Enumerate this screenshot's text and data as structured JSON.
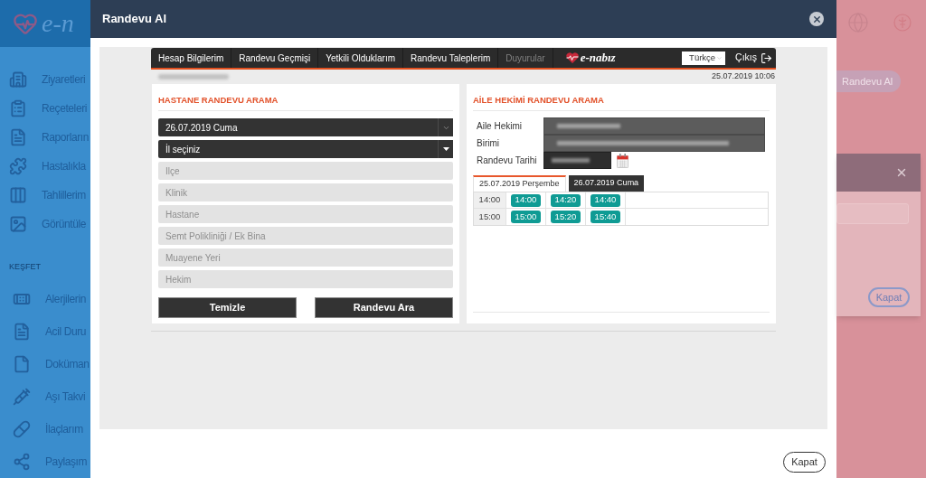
{
  "background": {
    "logo": "e-n",
    "sidebar": {
      "items": [
        "Ziyaretleri",
        "Reçeteleri",
        "Raporların",
        "Hastalıkla",
        "Tahlillerim",
        "Görüntüle"
      ],
      "section": {
        "title": "KEŞFET",
        "items": [
          "Alerjilerin",
          "Acil Duru",
          "Doküman",
          "Aşı Takvi",
          "İlaçlarım",
          "Paylaşım"
        ]
      }
    },
    "right": {
      "button": "Randevu Al",
      "dialog": {
        "button": "Kapat"
      }
    }
  },
  "modal": {
    "title": "Randevu Al",
    "footer_button": "Kapat"
  },
  "nav": {
    "items": [
      {
        "label": "Hesap Bilgilerim",
        "disabled": false
      },
      {
        "label": "Randevu Geçmişi",
        "disabled": false
      },
      {
        "label": "Yetkili Olduklarım",
        "disabled": false
      },
      {
        "label": "Randevu Taleplerim",
        "disabled": false
      },
      {
        "label": "Duyurular",
        "disabled": true
      }
    ],
    "logo": "e-nabız",
    "language": "Türkçe",
    "logout": "Çıkış"
  },
  "timestamp": "25.07.2019 10:06",
  "hospital_search": {
    "title": "HASTANE RANDEVU ARAMA",
    "fields": [
      {
        "kind": "date",
        "value": "26.07.2019 Cuma",
        "disabled": false
      },
      {
        "kind": "select",
        "value": "İl seçiniz",
        "disabled": false
      },
      {
        "kind": "select",
        "placeholder": "İlçe",
        "disabled": true
      },
      {
        "kind": "select",
        "placeholder": "Klinik",
        "disabled": true
      },
      {
        "kind": "select",
        "placeholder": "Hastane",
        "disabled": true
      },
      {
        "kind": "select",
        "placeholder": "Semt Polikliniği / Ek Bina",
        "disabled": true
      },
      {
        "kind": "select",
        "placeholder": "Muayene Yeri",
        "disabled": true
      },
      {
        "kind": "select",
        "placeholder": "Hekim",
        "disabled": true
      }
    ],
    "buttons": [
      "Temizle",
      "Randevu Ara"
    ]
  },
  "family_doctor": {
    "title": "AİLE HEKİMİ RANDEVU ARAMA",
    "fields": [
      {
        "label": "Aile Hekimi",
        "kind": "text"
      },
      {
        "label": "Birimi",
        "kind": "text"
      },
      {
        "label": "Randevu Tarihi",
        "kind": "date"
      }
    ],
    "tabs": [
      {
        "label": "25.07.2019 Perşembe",
        "selected": true
      },
      {
        "label": "26.07.2019 Cuma",
        "selected": false
      }
    ],
    "schedule": [
      {
        "hour": "14:00",
        "slots": [
          "14:00",
          "14:20",
          "14:40"
        ]
      },
      {
        "hour": "15:00",
        "slots": [
          "15:00",
          "15:20",
          "15:40"
        ]
      }
    ]
  }
}
